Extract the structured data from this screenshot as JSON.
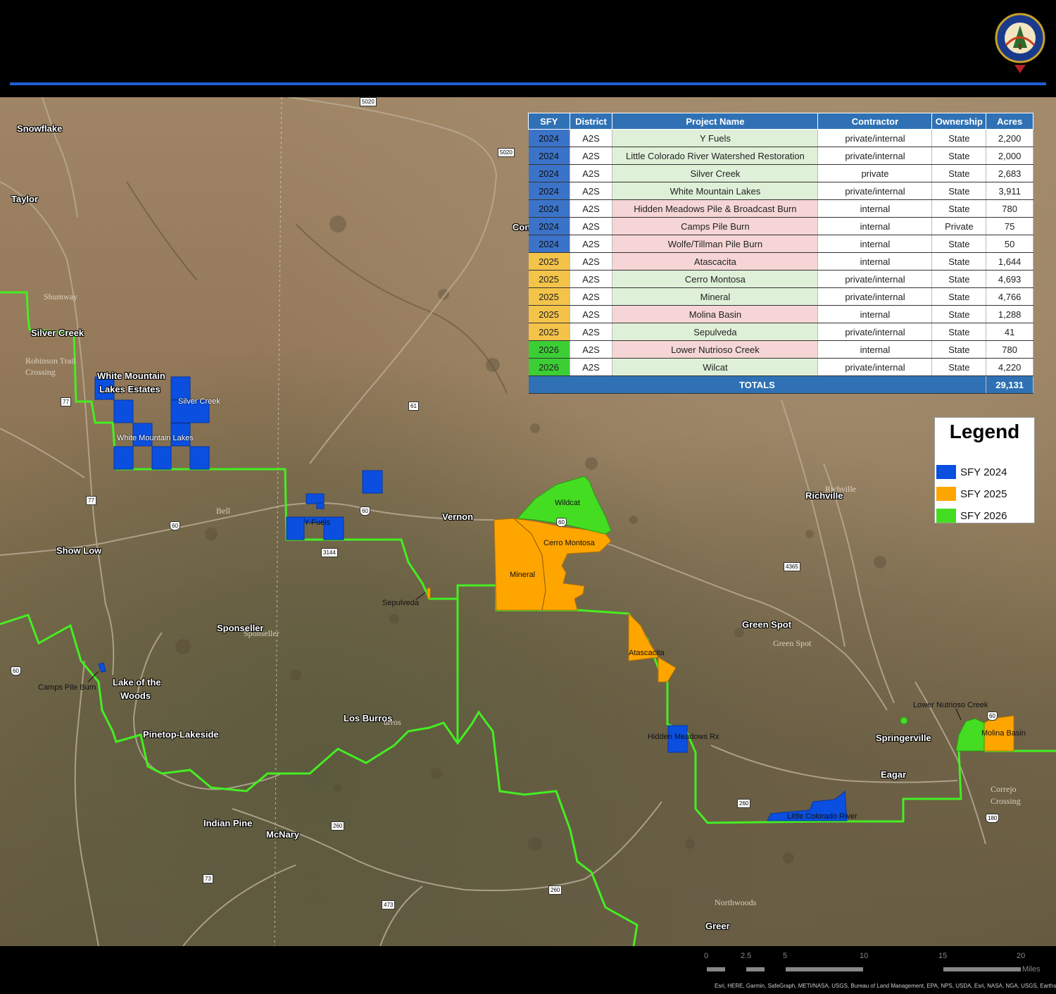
{
  "header": {
    "logo_text": "DEPARTMENT OF FORESTRY AND FIRE MANAGEMENT",
    "logo_state": "AZ"
  },
  "table": {
    "columns": [
      "SFY",
      "District",
      "Project Name",
      "Contractor",
      "Ownership",
      "Acres"
    ],
    "rows": [
      {
        "sfy": "2024",
        "district": "A2S",
        "name": "Y Fuels",
        "contractor": "private/internal",
        "ownership": "State",
        "acres": "2,200",
        "shade": "green"
      },
      {
        "sfy": "2024",
        "district": "A2S",
        "name": "Little Colorado River Watershed Restoration",
        "contractor": "private/internal",
        "ownership": "State",
        "acres": "2,000",
        "shade": "green"
      },
      {
        "sfy": "2024",
        "district": "A2S",
        "name": "Silver Creek",
        "contractor": "private",
        "ownership": "State",
        "acres": "2,683",
        "shade": "green"
      },
      {
        "sfy": "2024",
        "district": "A2S",
        "name": "White Mountain Lakes",
        "contractor": "private/internal",
        "ownership": "State",
        "acres": "3,911",
        "shade": "green"
      },
      {
        "sfy": "2024",
        "district": "A2S",
        "name": "Hidden Meadows Pile & Broadcast Burn",
        "contractor": "internal",
        "ownership": "State",
        "acres": "780",
        "shade": "pink"
      },
      {
        "sfy": "2024",
        "district": "A2S",
        "name": "Camps Pile Burn",
        "contractor": "internal",
        "ownership": "Private",
        "acres": "75",
        "shade": "pink"
      },
      {
        "sfy": "2024",
        "district": "A2S",
        "name": "Wolfe/Tillman Pile Burn",
        "contractor": "internal",
        "ownership": "State",
        "acres": "50",
        "shade": "pink"
      },
      {
        "sfy": "2025",
        "district": "A2S",
        "name": "Atascacita",
        "contractor": "internal",
        "ownership": "State",
        "acres": "1,644",
        "shade": "pink"
      },
      {
        "sfy": "2025",
        "district": "A2S",
        "name": "Cerro Montosa",
        "contractor": "private/internal",
        "ownership": "State",
        "acres": "4,693",
        "shade": "green"
      },
      {
        "sfy": "2025",
        "district": "A2S",
        "name": "Mineral",
        "contractor": "private/internal",
        "ownership": "State",
        "acres": "4,766",
        "shade": "green"
      },
      {
        "sfy": "2025",
        "district": "A2S",
        "name": "Molina Basin",
        "contractor": "internal",
        "ownership": "State",
        "acres": "1,288",
        "shade": "pink"
      },
      {
        "sfy": "2025",
        "district": "A2S",
        "name": "Sepulveda",
        "contractor": "private/internal",
        "ownership": "State",
        "acres": "41",
        "shade": "green"
      },
      {
        "sfy": "2026",
        "district": "A2S",
        "name": "Lower Nutrioso Creek",
        "contractor": "internal",
        "ownership": "State",
        "acres": "780",
        "shade": "pink"
      },
      {
        "sfy": "2026",
        "district": "A2S",
        "name": "Wilcat",
        "contractor": "private/internal",
        "ownership": "State",
        "acres": "4,220",
        "shade": "green"
      }
    ],
    "totals_label": "TOTALS",
    "totals_value": "29,131"
  },
  "legend": {
    "title": "Legend",
    "items": [
      {
        "label": "SFY 2024",
        "color": "#0a4fe0"
      },
      {
        "label": "SFY 2025",
        "color": "#ffa500"
      },
      {
        "label": "SFY 2026",
        "color": "#44dd22"
      }
    ]
  },
  "places": {
    "snowflake": "Snowflake",
    "taylor": "Taylor",
    "shumway": "Shumway",
    "silver_creek_town": "Silver Creek",
    "robinson": "Robinson Trail",
    "crossing": "Crossing",
    "wml_estates_1": "White Mountain",
    "wml_estates_2": "Lakes Estates",
    "show_low": "Show Low",
    "bell": "Bell",
    "vernon": "Vernon",
    "con": "Con",
    "richville": "Richville",
    "richville_faint": "Richville",
    "sponseller": "Sponseller",
    "sponseller_faint": "Sponseller",
    "lake_woods_1": "Lake of the",
    "lake_woods_2": "Woods",
    "pinetop": "Pinetop-Lakeside",
    "los_burros": "Los Burros",
    "burros_faint": "urros",
    "green_spot": "Green Spot",
    "green_spot_faint": "Green Spot",
    "springerville": "Springerville",
    "eagar": "Eagar",
    "correjo_1": "Correjo",
    "correjo_2": "Crossing",
    "indian_pine": "Indian Pine",
    "mcnary": "McNary",
    "northwoods": "Northwoods",
    "greer": "Greer"
  },
  "projects_on_map": {
    "silver_creek": "Silver Creek",
    "white_mountain_lakes": "White Mountain Lakes",
    "y_fuels": "Y-Fuels",
    "wildcat": "Wildcat",
    "cerro_montosa": "Cerro Montosa",
    "mineral": "Mineral",
    "sepulveda": "Sepulveda",
    "atascacita": "Atascacita",
    "camps_pile_burn": "Camps Pile Burn",
    "hidden_meadows": "Hidden Meadows Rx",
    "little_colorado": "Little Colorado River",
    "lower_nutrioso": "Lower Nutrioso Creek",
    "molina_basin": "Molina Basin"
  },
  "shields": {
    "s5020a": "5020",
    "s5020b": "5020",
    "s61": "61",
    "s77a": "77",
    "s77b": "77",
    "s60a": "60",
    "s60b": "60",
    "s60c": "60",
    "s60d": "60",
    "s3144": "3144",
    "s4365": "4365",
    "s260a": "260",
    "s260b": "260",
    "s260c": "260",
    "s73": "73",
    "s473": "473",
    "s180": "180"
  },
  "scale": {
    "ticks": [
      "0",
      "2.5",
      "5",
      "10",
      "15",
      "20"
    ],
    "unit": "Miles"
  },
  "attribution": "Esri, HERE, Garmin, SafeGraph, METI/NASA, USGS, Bureau of Land Management, EPA, NPS, USDA, Esri, NASA, NGA, USGS, Earthstar Geographics"
}
